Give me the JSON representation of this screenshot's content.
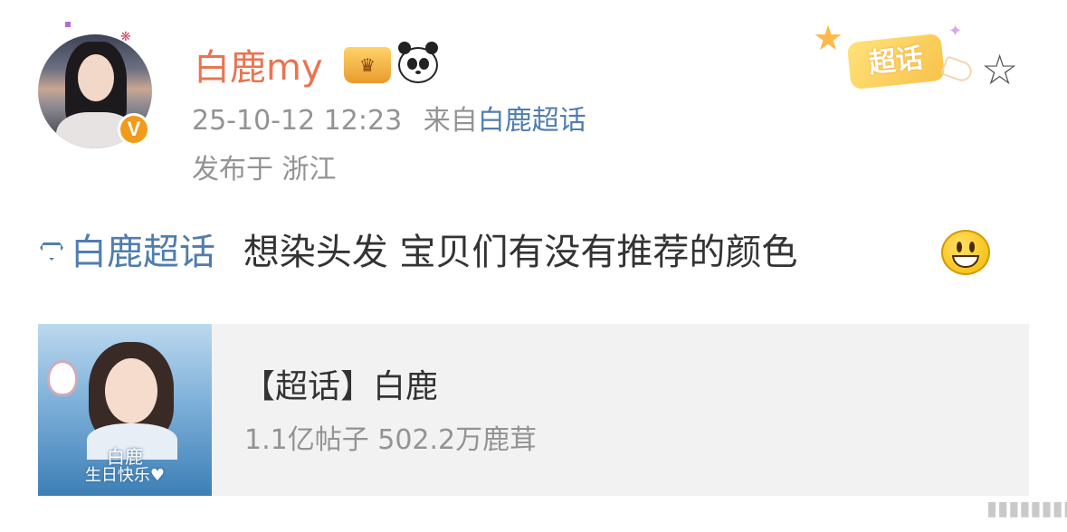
{
  "post_header": {
    "username": "白鹿my",
    "timestamp": "25-10-12 12:23",
    "source_prefix": "来自",
    "source": "白鹿超话",
    "location": "发布于 浙江",
    "verified_badge": "V"
  },
  "sticker": {
    "label": "超话"
  },
  "post": {
    "topic": "白鹿超话",
    "text": "想染头发 宝贝们有没有推荐的颜色"
  },
  "card": {
    "title": "【超话】白鹿",
    "stats": "1.1亿帖子 502.2万鹿茸",
    "cover_title": "白鹿",
    "cover_subtitle": "生日快乐♥"
  },
  "icons": {
    "favorite": "star-outline-icon",
    "topic": "diamond-icon",
    "emoji": "grinning-face-icon",
    "crown": "crown-icon",
    "panda": "panda-icon"
  },
  "colors": {
    "username": "#eb7350",
    "link": "#507daf",
    "meta": "#939393",
    "card_bg": "#f2f2f2"
  }
}
